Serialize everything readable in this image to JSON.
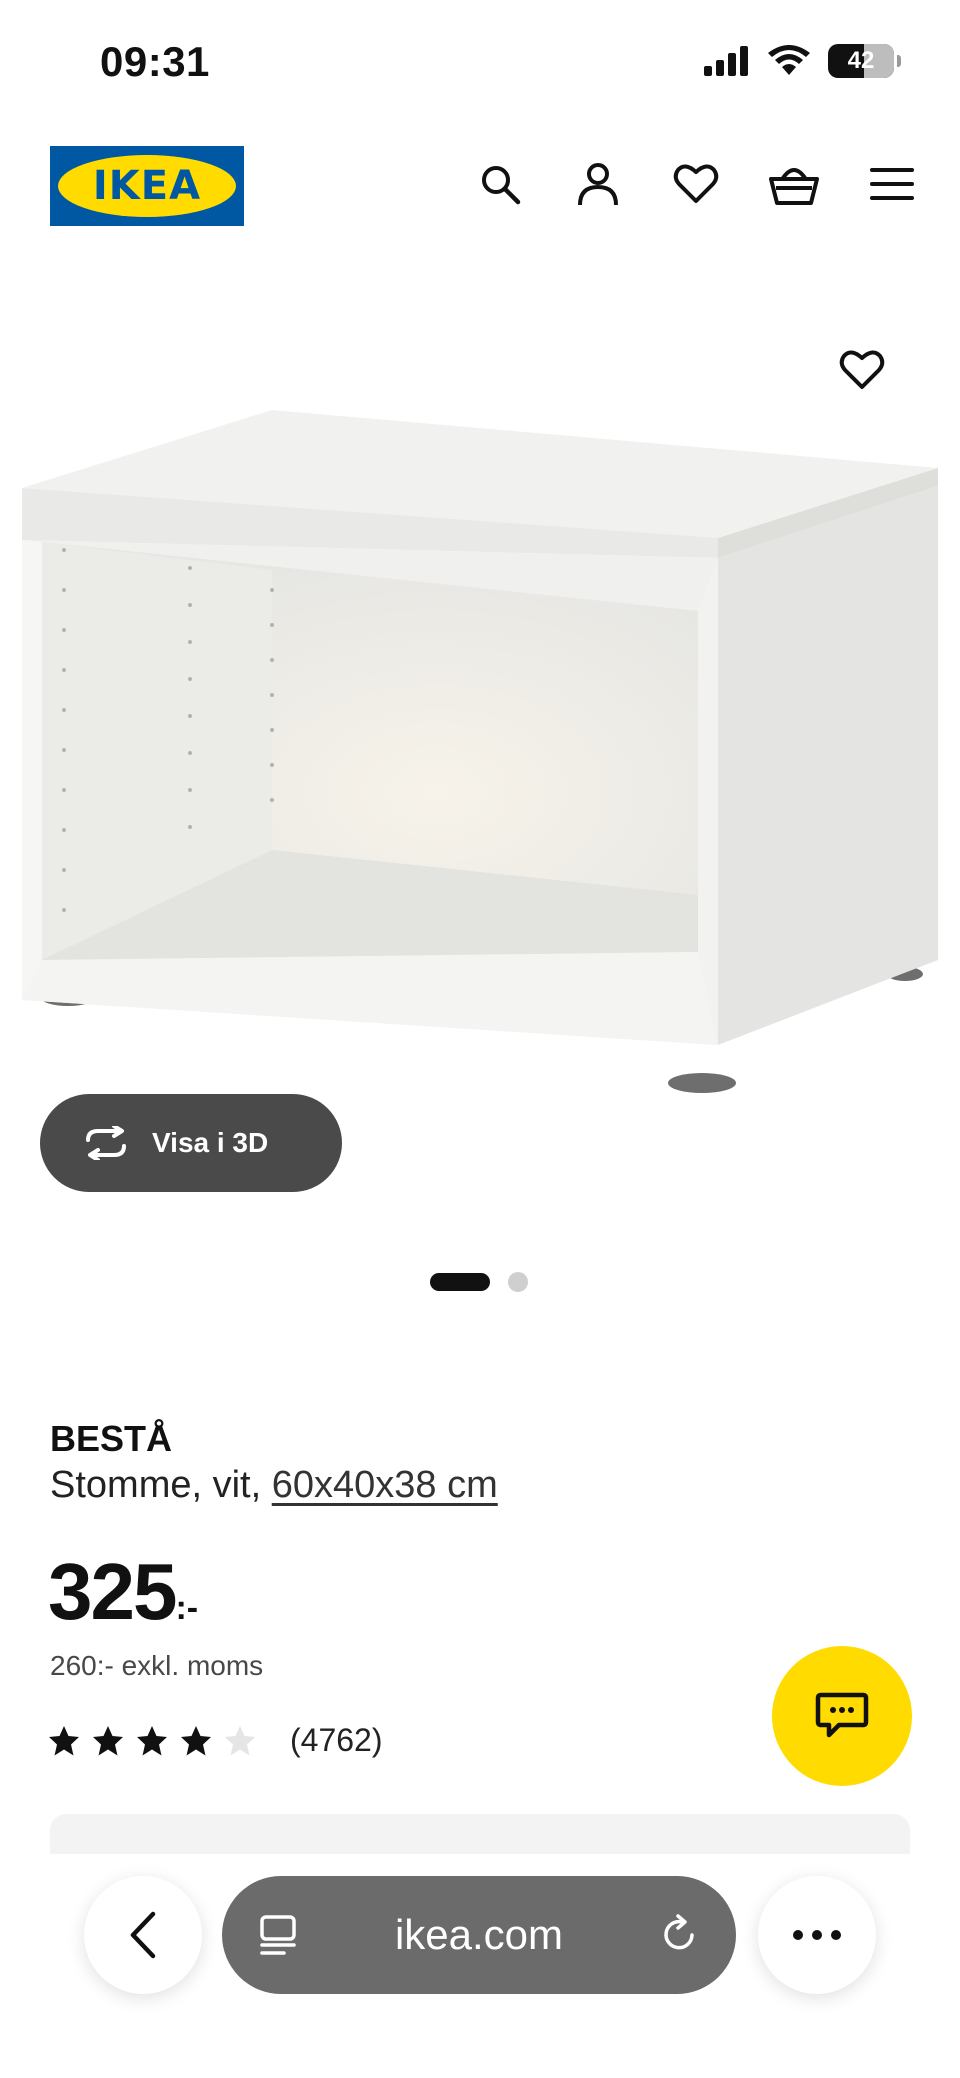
{
  "status_bar": {
    "time": "09:31",
    "battery": "42",
    "icons": [
      "signal-icon",
      "wifi-icon",
      "battery-icon"
    ]
  },
  "header": {
    "logo_text": "IKEA",
    "brand_colors": {
      "blue": "#0058a3",
      "yellow": "#ffdb00"
    },
    "icons": [
      "search-icon",
      "account-icon",
      "heart-icon",
      "basket-icon",
      "menu-icon"
    ]
  },
  "gallery": {
    "view_3d_label": "Visa i 3D",
    "slide_count": 2,
    "active_slide": 1
  },
  "product": {
    "name": "BESTÅ",
    "description": "Stomme, vit,",
    "dimensions": "60x40x38 cm",
    "price": "325",
    "price_suffix": ":-",
    "price_ex_vat": "260:- exkl. moms",
    "rating": 4,
    "rating_max": 5,
    "review_count": "(4762)"
  },
  "chat": {
    "icon": "chat-icon",
    "color": "#ffdb00"
  },
  "browser": {
    "url": "ikea.com",
    "icons": [
      "back-icon",
      "tabs-icon",
      "reload-icon",
      "more-icon"
    ]
  }
}
